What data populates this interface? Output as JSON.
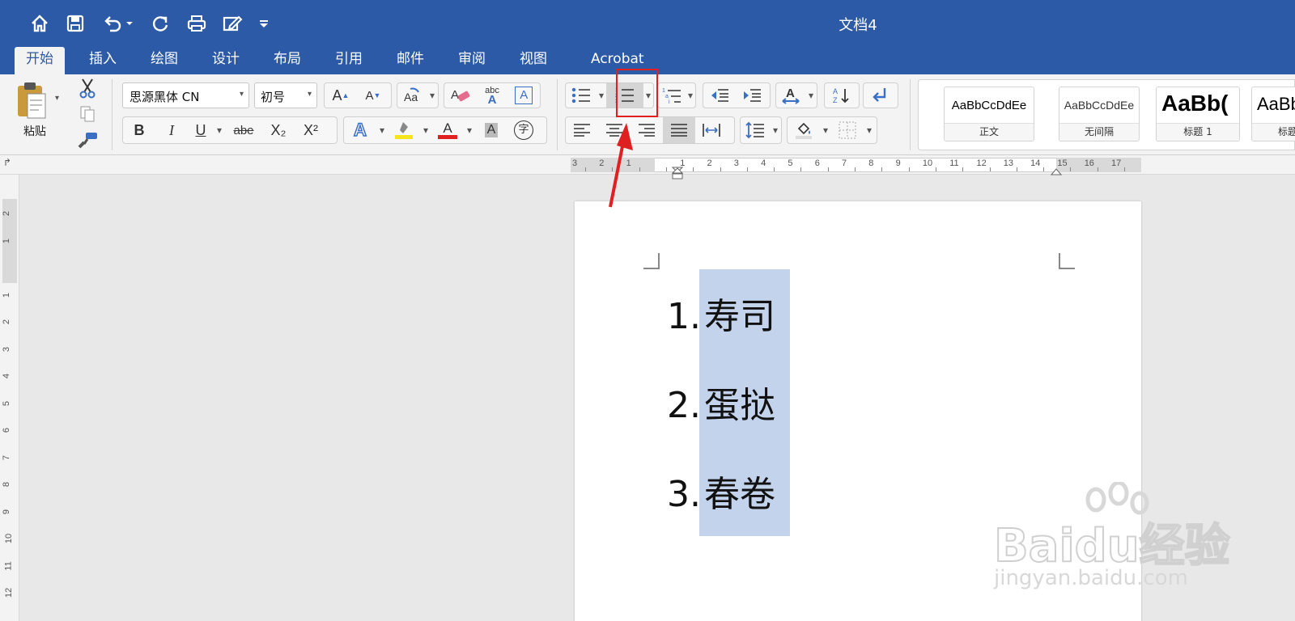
{
  "window": {
    "doc_title": "文档4"
  },
  "quick_access": {
    "icons": [
      "home-icon",
      "save-icon",
      "undo-icon",
      "dropdown-caret-icon",
      "redo-icon",
      "print-icon",
      "edit-icon",
      "customize-dropdown-icon"
    ]
  },
  "tabs": [
    {
      "label": "开始",
      "active": true
    },
    {
      "label": "插入"
    },
    {
      "label": "绘图"
    },
    {
      "label": "设计"
    },
    {
      "label": "布局"
    },
    {
      "label": "引用"
    },
    {
      "label": "邮件"
    },
    {
      "label": "审阅"
    },
    {
      "label": "视图"
    },
    {
      "label": "Acrobat"
    }
  ],
  "clipboard": {
    "paste_label": "粘贴"
  },
  "font": {
    "name": "思源黑体 CN",
    "size": "初号"
  },
  "format": {
    "bold": "B",
    "italic": "I",
    "underline": "U",
    "strike": "abe",
    "subscript": "X₂",
    "superscript": "X²",
    "clear_fmt_text": "abc",
    "char_shading": "A",
    "enclosed": "字",
    "grow": "A",
    "shrink": "A"
  },
  "styles": [
    {
      "preview": "AaBbCcDdEe",
      "name": "正文"
    },
    {
      "preview": "AaBbCcDdEe",
      "name": "无间隔"
    },
    {
      "preview": "AaBb(",
      "name": "标题 1"
    },
    {
      "preview": "AaBb",
      "name": "标题"
    }
  ],
  "ruler": {
    "h_labels": [
      "3",
      "2",
      "1",
      "",
      "1",
      "2",
      "3",
      "4",
      "5",
      "6",
      "7",
      "8",
      "9",
      "10",
      "11",
      "12",
      "13",
      "14",
      "15",
      "16",
      "17"
    ],
    "v_labels": [
      "2",
      "1",
      "",
      "1",
      "2",
      "3",
      "4",
      "5",
      "6",
      "7",
      "8",
      "9",
      "10",
      "11",
      "12"
    ]
  },
  "document": {
    "list": [
      {
        "number": "1.",
        "text": "寿司"
      },
      {
        "number": "2.",
        "text": "蛋挞"
      },
      {
        "number": "3.",
        "text": "春卷"
      }
    ]
  },
  "annotation": {
    "highlight_color": "#e02020"
  },
  "watermark": {
    "brand": "Baidu经验",
    "url": "jingyan.baidu.com"
  },
  "colors": {
    "title_bar": "#2c5aa6",
    "selection": "#c3d3ec",
    "accent": "#2c5aa6"
  }
}
